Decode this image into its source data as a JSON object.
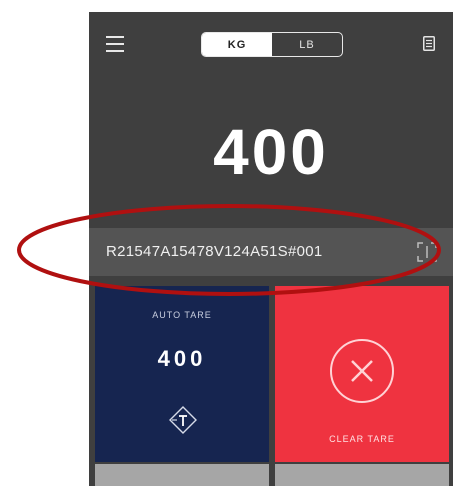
{
  "header": {
    "units": [
      {
        "label": "KG",
        "active": true
      },
      {
        "label": "LB",
        "active": false
      }
    ]
  },
  "display": {
    "weight": "400"
  },
  "barcode": {
    "value": "R21547A15478V124A51S#001"
  },
  "tiles": {
    "auto_tare": {
      "label": "AUTO TARE",
      "value": "400",
      "icon": "tare-icon"
    },
    "clear_tare": {
      "label": "CLEAR TARE",
      "icon": "close-circle-icon"
    }
  },
  "colors": {
    "header_bg": "#3f3f3f",
    "barcode_bg": "#545454",
    "auto_tare_bg": "#162550",
    "clear_tare_bg": "#ef3340",
    "annotation": "#b01010"
  },
  "icons": [
    "menu-icon",
    "document-icon",
    "scan-icon",
    "tare-icon",
    "close-circle-icon"
  ]
}
